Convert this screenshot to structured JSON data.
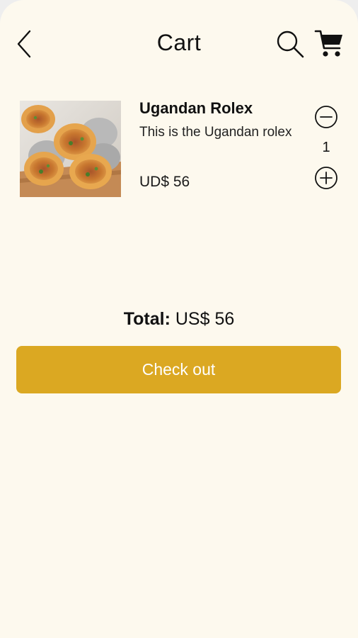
{
  "header": {
    "back_icon": "chevron-left-icon",
    "title": "Cart",
    "search_icon": "search-icon",
    "cart_icon": "shopping-cart-icon"
  },
  "cart": {
    "items": [
      {
        "name": "Ugandan Rolex",
        "description": "This is the Ugandan rolex",
        "price": "UD$ 56",
        "quantity": "1",
        "minus_icon": "minus-circle-icon",
        "plus_icon": "plus-circle-icon"
      }
    ]
  },
  "total": {
    "label": "Total:",
    "value": "US$ 56"
  },
  "checkout": {
    "label": "Check out"
  },
  "colors": {
    "background": "#fdf9ee",
    "accent": "#dba822",
    "text": "#111111"
  }
}
